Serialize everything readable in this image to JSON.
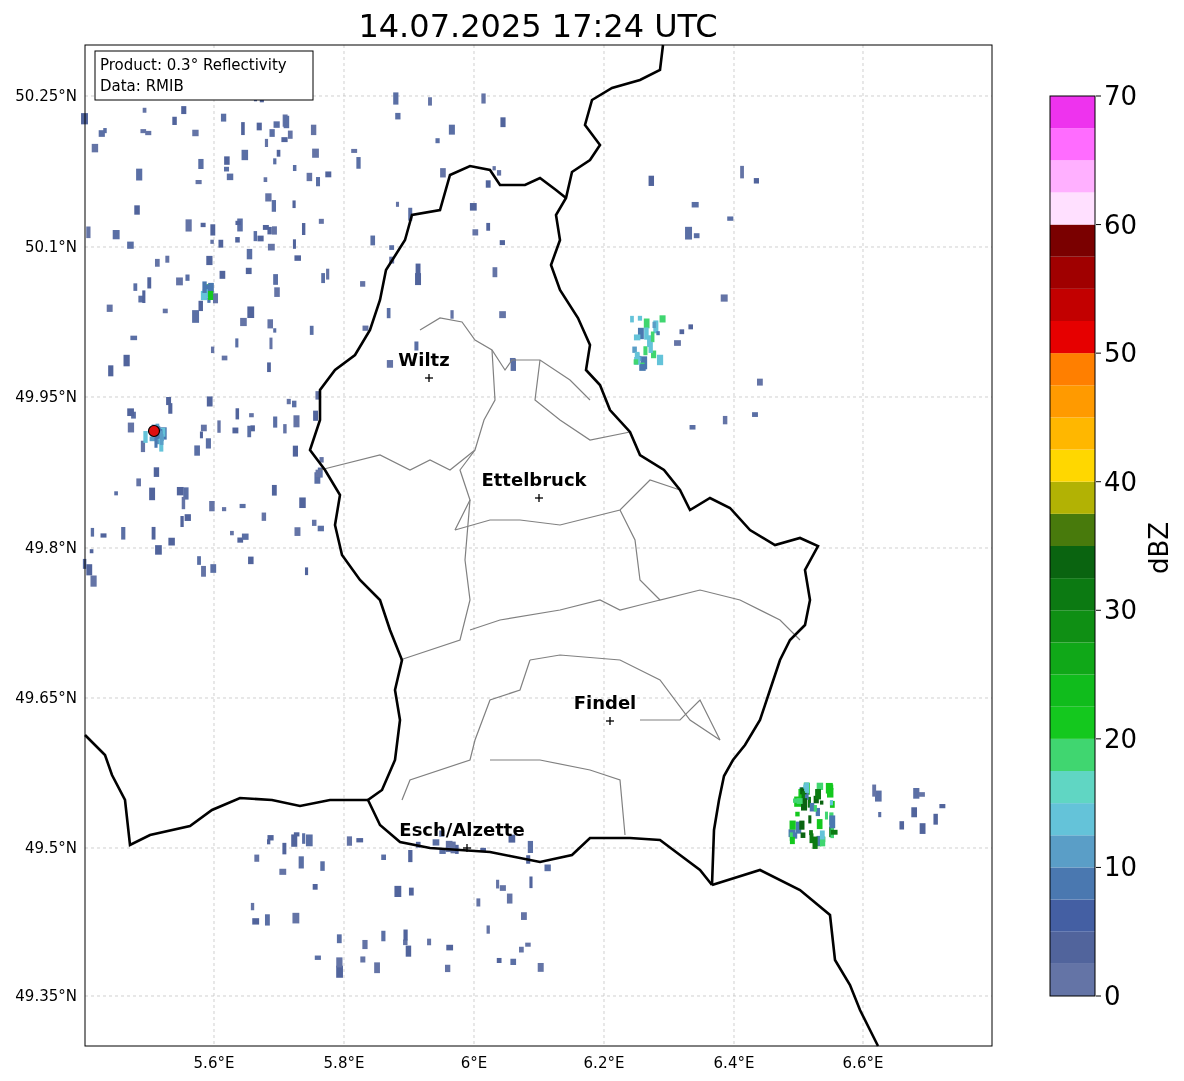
{
  "title": "14.07.2025 17:24 UTC",
  "info_box": [
    "Product: 0.3° Reflectivity",
    "Data: RMIB"
  ],
  "map": {
    "yticks": [
      "50.25°N",
      "50.1°N",
      "49.95°N",
      "49.8°N",
      "49.65°N",
      "49.5°N",
      "49.35°N"
    ],
    "xticks": [
      "5.6°E",
      "5.8°E",
      "6°E",
      "6.2°E",
      "6.4°E",
      "6.6°E"
    ],
    "cities": [
      {
        "name": "Wiltz"
      },
      {
        "name": "Ettelbruck"
      },
      {
        "name": "Findel"
      },
      {
        "name": "Esch/Alzette"
      }
    ]
  },
  "colorbar": {
    "label": "dBZ",
    "ticks": [
      "70",
      "60",
      "50",
      "40",
      "30",
      "20",
      "10",
      "0"
    ]
  }
}
